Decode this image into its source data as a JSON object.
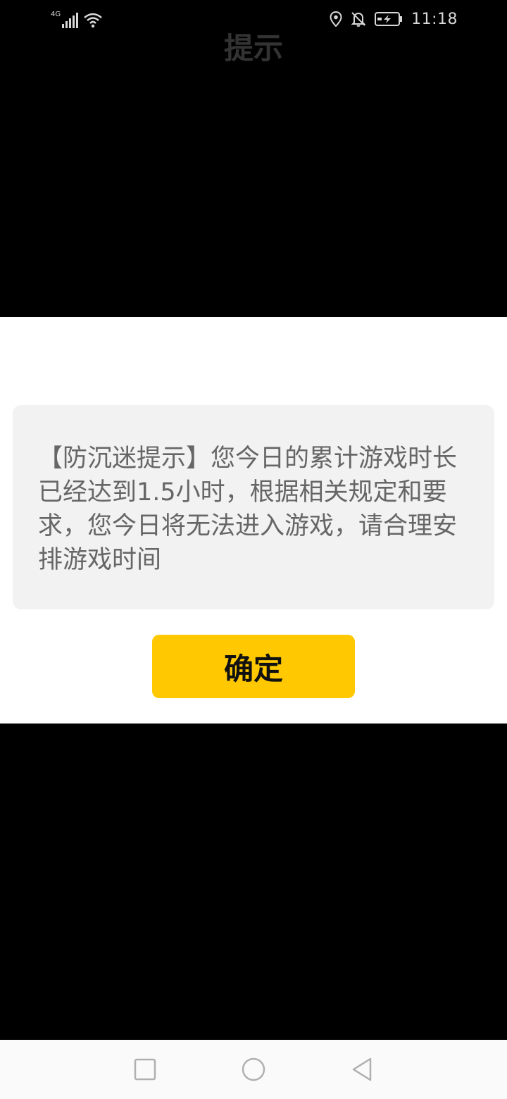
{
  "status_bar": {
    "network_type": "4G",
    "time": "11:18",
    "icons": [
      "signal-icon",
      "wifi-icon",
      "location-icon",
      "bell-off-icon",
      "battery-charging-icon"
    ]
  },
  "dialog": {
    "title": "提示",
    "message": "【防沉迷提示】您今日的累计游戏时长已经达到1.5小时，根据相关规定和要求，您今日将无法进入游戏，请合理安排游戏时间",
    "confirm_label": "确定",
    "accent_color": "#ffc800"
  },
  "nav_bar": {
    "icons": [
      "recent-apps-icon",
      "home-icon",
      "back-icon"
    ]
  }
}
